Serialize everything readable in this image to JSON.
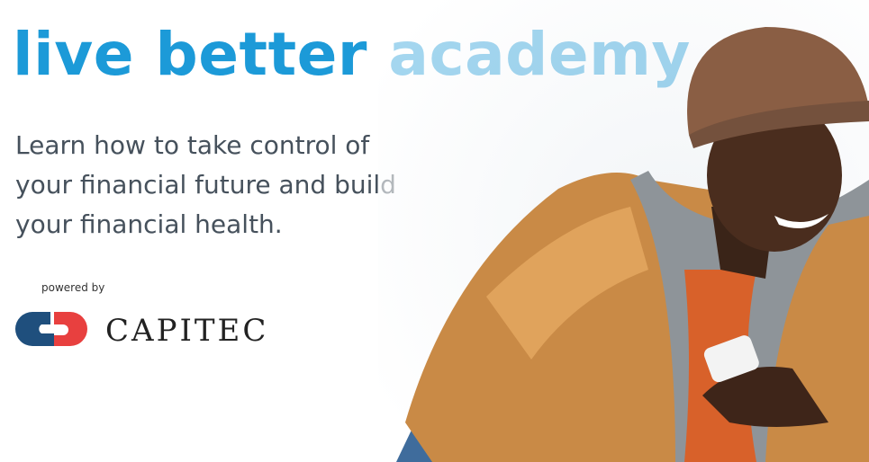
{
  "banner": {
    "title": "live better academy",
    "description": "Learn how to take control of your financial future and build your financial health.",
    "powered_by": "powered by",
    "brand": "CAPITEC"
  },
  "colors": {
    "title": "#1c9ad8",
    "text": "#46515c",
    "logo_blue": "#1f4f7d",
    "logo_red": "#e8403f"
  }
}
